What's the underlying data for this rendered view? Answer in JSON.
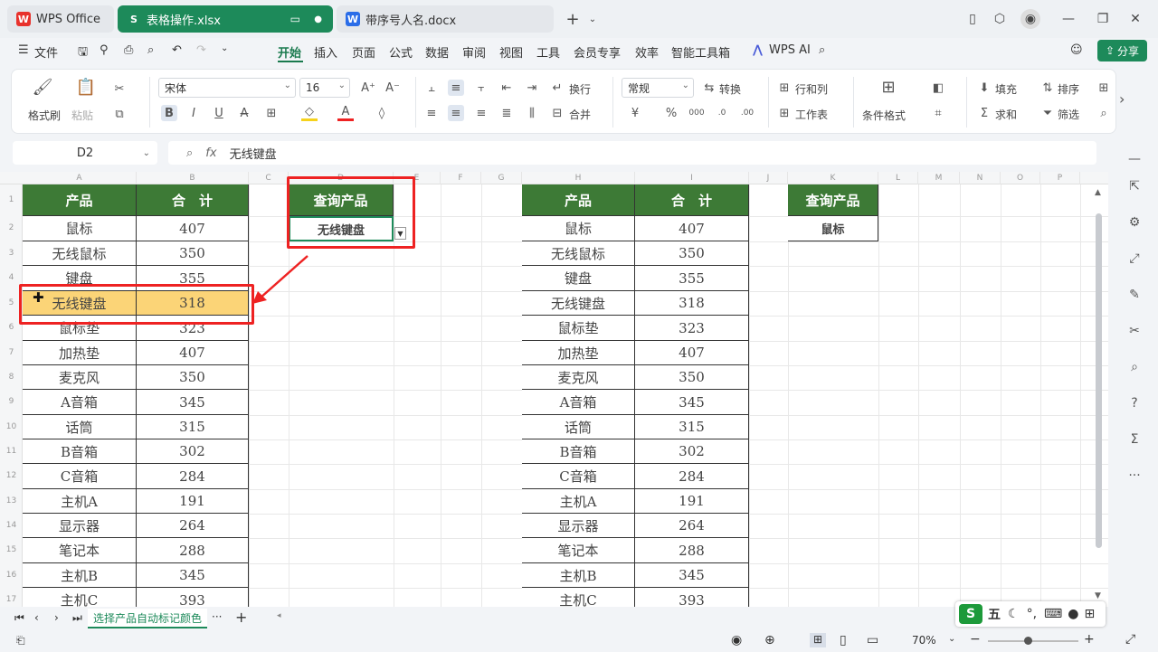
{
  "tabs": [
    {
      "label": "WPS Office",
      "icon": "wps-logo-icon"
    },
    {
      "label": "表格操作.xlsx",
      "icon": "spreadsheet-icon"
    },
    {
      "label": "带序号人名.docx",
      "icon": "word-doc-icon"
    }
  ],
  "menu": [
    "文件",
    "开始",
    "插入",
    "页面",
    "公式",
    "数据",
    "审阅",
    "视图",
    "工具",
    "会员专享",
    "效率",
    "智能工具箱",
    "WPS AI"
  ],
  "menu_active": "开始",
  "share_label": "分享",
  "ribbon": {
    "format_painter": "格式刷",
    "paste": "粘贴",
    "font_name": "宋体",
    "font_size": "16",
    "wrap": "换行",
    "merge": "合并",
    "number_format": "常规",
    "convert": "转换",
    "row_col": "行和列",
    "worksheet": "工作表",
    "cond_format": "条件格式",
    "fill": "填充",
    "sort": "排序",
    "sum": "求和",
    "filter": "筛选"
  },
  "formula_bar": {
    "name_box": "D2",
    "fx": "fx",
    "content": "无线键盘"
  },
  "columns": [
    "A",
    "B",
    "C",
    "D",
    "E",
    "F",
    "G",
    "H",
    "I",
    "J",
    "K",
    "L",
    "M",
    "N",
    "O",
    "P"
  ],
  "rows": [
    "1",
    "2",
    "3",
    "4",
    "5",
    "6",
    "7",
    "8",
    "9",
    "10",
    "11",
    "12",
    "13",
    "14",
    "15",
    "16",
    "17"
  ],
  "table_left": {
    "headers": [
      "产品",
      "合　计"
    ],
    "rows": [
      [
        "鼠标",
        "407"
      ],
      [
        "无线鼠标",
        "350"
      ],
      [
        "键盘",
        "355"
      ],
      [
        "无线键盘",
        "318"
      ],
      [
        "鼠标垫",
        "323"
      ],
      [
        "加热垫",
        "407"
      ],
      [
        "麦克风",
        "350"
      ],
      [
        "A音箱",
        "345"
      ],
      [
        "话筒",
        "315"
      ],
      [
        "B音箱",
        "302"
      ],
      [
        "C音箱",
        "284"
      ],
      [
        "主机A",
        "191"
      ],
      [
        "显示器",
        "264"
      ],
      [
        "笔记本",
        "288"
      ],
      [
        "主机B",
        "345"
      ],
      [
        "主机C",
        "393"
      ]
    ],
    "highlighted_row": 3
  },
  "query_left": {
    "header": "查询产品",
    "value": "无线键盘"
  },
  "table_right": {
    "headers": [
      "产品",
      "合　计"
    ],
    "rows": [
      [
        "鼠标",
        "407"
      ],
      [
        "无线鼠标",
        "350"
      ],
      [
        "键盘",
        "355"
      ],
      [
        "无线键盘",
        "318"
      ],
      [
        "鼠标垫",
        "323"
      ],
      [
        "加热垫",
        "407"
      ],
      [
        "麦克风",
        "350"
      ],
      [
        "A音箱",
        "345"
      ],
      [
        "话筒",
        "315"
      ],
      [
        "B音箱",
        "302"
      ],
      [
        "C音箱",
        "284"
      ],
      [
        "主机A",
        "191"
      ],
      [
        "显示器",
        "264"
      ],
      [
        "笔记本",
        "288"
      ],
      [
        "主机B",
        "345"
      ],
      [
        "主机C",
        "393"
      ]
    ]
  },
  "query_right": {
    "header": "查询产品",
    "value": "鼠标"
  },
  "sheet_tab": "选择产品自动标记颜色",
  "zoom": "70%",
  "ime_label": "五"
}
